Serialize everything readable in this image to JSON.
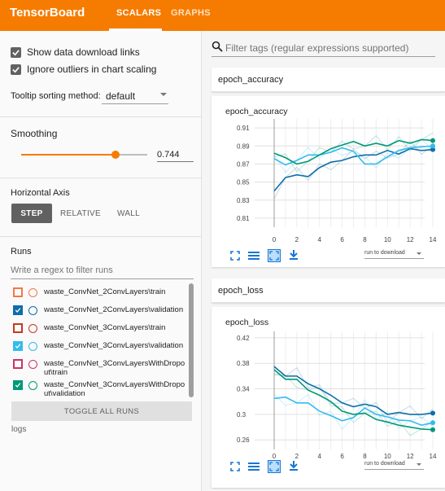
{
  "app": {
    "brand": "TensorBoard",
    "tabs": [
      {
        "label": "SCALARS",
        "active": true
      },
      {
        "label": "GRAPHS",
        "active": false
      }
    ],
    "accent_color": "#f57c00"
  },
  "sidebar": {
    "show_download_label": "Show data download links",
    "ignore_outliers_label": "Ignore outliers in chart scaling",
    "tooltip_label": "Tooltip sorting method:",
    "tooltip_value": "default",
    "smoothing_label": "Smoothing",
    "smoothing_value": "0.744",
    "smoothing_fraction": 0.744,
    "horizontal_axis_label": "Horizontal Axis",
    "axis_buttons": [
      "STEP",
      "RELATIVE",
      "WALL"
    ],
    "runs_label": "Runs",
    "runs_filter_placeholder": "Write a regex to filter runs",
    "runs": [
      {
        "name": "waste_ConvNet_2ConvLayers\\train",
        "color": "#f4774a",
        "checked": false
      },
      {
        "name": "waste_ConvNet_2ConvLayers\\validation",
        "color": "#0d6ea8",
        "checked": true
      },
      {
        "name": "waste_ConvNet_3ConvLayers\\train",
        "color": "#c23b22",
        "checked": false
      },
      {
        "name": "waste_ConvNet_3ConvLayers\\validation",
        "color": "#33bbee",
        "checked": true
      },
      {
        "name": "waste_ConvNet_3ConvLayersWithDropout\\train",
        "color": "#cc3366",
        "checked": false
      },
      {
        "name": "waste_ConvNet_3ConvLayersWithDropout\\validation",
        "color": "#009977",
        "checked": true
      }
    ],
    "toggle_all_label": "TOGGLE ALL RUNS",
    "logs_label": "logs"
  },
  "main": {
    "search_placeholder": "Filter tags (regular expressions supported)",
    "run_download_label": "run to download"
  },
  "chart_data": [
    {
      "type": "line",
      "title": "epoch_accuracy",
      "header": "epoch_accuracy",
      "xlim": [
        0,
        14
      ],
      "ylim": [
        0.8,
        0.92
      ],
      "xticks": [
        "0",
        "2",
        "4",
        "6",
        "8",
        "10",
        "12",
        "14"
      ],
      "yticks": [
        "0.81",
        "0.83",
        "0.85",
        "0.87",
        "0.89",
        "0.91"
      ],
      "ytick_values": [
        0.81,
        0.83,
        0.85,
        0.87,
        0.89,
        0.91
      ],
      "grid": true,
      "x": [
        0,
        1,
        2,
        3,
        4,
        5,
        6,
        7,
        8,
        9,
        10,
        11,
        12,
        13,
        14
      ],
      "series": [
        {
          "color": "#0d6ea8",
          "values": [
            0.84,
            0.855,
            0.858,
            0.856,
            0.866,
            0.872,
            0.874,
            0.878,
            0.88,
            0.88,
            0.885,
            0.881,
            0.887,
            0.885,
            0.886
          ]
        },
        {
          "color": "#33bbee",
          "values": [
            0.876,
            0.869,
            0.874,
            0.88,
            0.88,
            0.883,
            0.888,
            0.884,
            0.87,
            0.87,
            0.878,
            0.885,
            0.888,
            0.889,
            0.89
          ]
        },
        {
          "color": "#009977",
          "values": [
            0.882,
            0.877,
            0.87,
            0.873,
            0.88,
            0.887,
            0.891,
            0.895,
            0.89,
            0.893,
            0.89,
            0.896,
            0.893,
            0.897,
            0.896
          ]
        }
      ]
    },
    {
      "type": "line",
      "title": "epoch_loss",
      "header": "epoch_loss",
      "xlim": [
        0,
        14
      ],
      "ylim": [
        0.245,
        0.43
      ],
      "xticks": [
        "0",
        "2",
        "4",
        "6",
        "8",
        "10",
        "12",
        "14"
      ],
      "yticks": [
        "0.42",
        "0.38",
        "0.34",
        "0.3",
        "0.26"
      ],
      "ytick_values": [
        0.42,
        0.38,
        0.34,
        0.3,
        0.26
      ],
      "grid": true,
      "x": [
        0,
        1,
        2,
        3,
        4,
        5,
        6,
        7,
        8,
        9,
        10,
        11,
        12,
        13,
        14
      ],
      "series": [
        {
          "color": "#0d6ea8",
          "values": [
            0.375,
            0.36,
            0.36,
            0.348,
            0.34,
            0.33,
            0.318,
            0.312,
            0.316,
            0.312,
            0.3,
            0.303,
            0.3,
            0.3,
            0.302
          ]
        },
        {
          "color": "#33bbee",
          "values": [
            0.325,
            0.327,
            0.318,
            0.318,
            0.305,
            0.298,
            0.29,
            0.295,
            0.31,
            0.3,
            0.296,
            0.291,
            0.29,
            0.283,
            0.287
          ]
        },
        {
          "color": "#009977",
          "values": [
            0.37,
            0.355,
            0.355,
            0.338,
            0.33,
            0.32,
            0.305,
            0.3,
            0.302,
            0.292,
            0.288,
            0.283,
            0.28,
            0.277,
            0.276
          ]
        }
      ]
    }
  ]
}
